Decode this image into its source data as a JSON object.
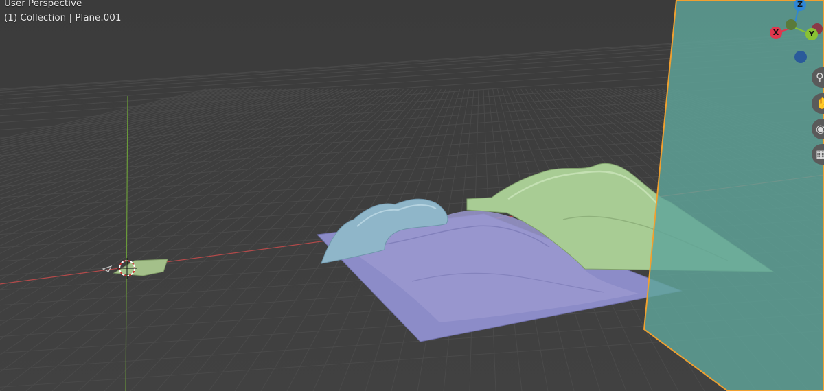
{
  "viewport": {
    "perspective_label": "User Perspective",
    "collection_label": "(1) Collection | Plane.001"
  },
  "gizmo": {
    "x_label": "X",
    "y_label": "Y",
    "z_label": "Z",
    "x_color": "#e0374e",
    "y_color": "#89c233",
    "z_color": "#2f86d6"
  },
  "nav_buttons": {
    "zoom_icon": "zoom-icon",
    "pan_icon": "hand-icon",
    "camera_icon": "camera-icon",
    "ortho_icon": "grid-icon"
  },
  "colors": {
    "background": "#3d3d3d",
    "grid": "#4a4a4a",
    "x_axis": "#b24a4a",
    "y_axis": "#6a9a3a",
    "selected_outline": "#f0a030",
    "terrain_blue": "#8fb6c9",
    "terrain_purple": "#8c8cc8",
    "terrain_green": "#a8cc94",
    "plane_teal": "#5fa59a"
  }
}
